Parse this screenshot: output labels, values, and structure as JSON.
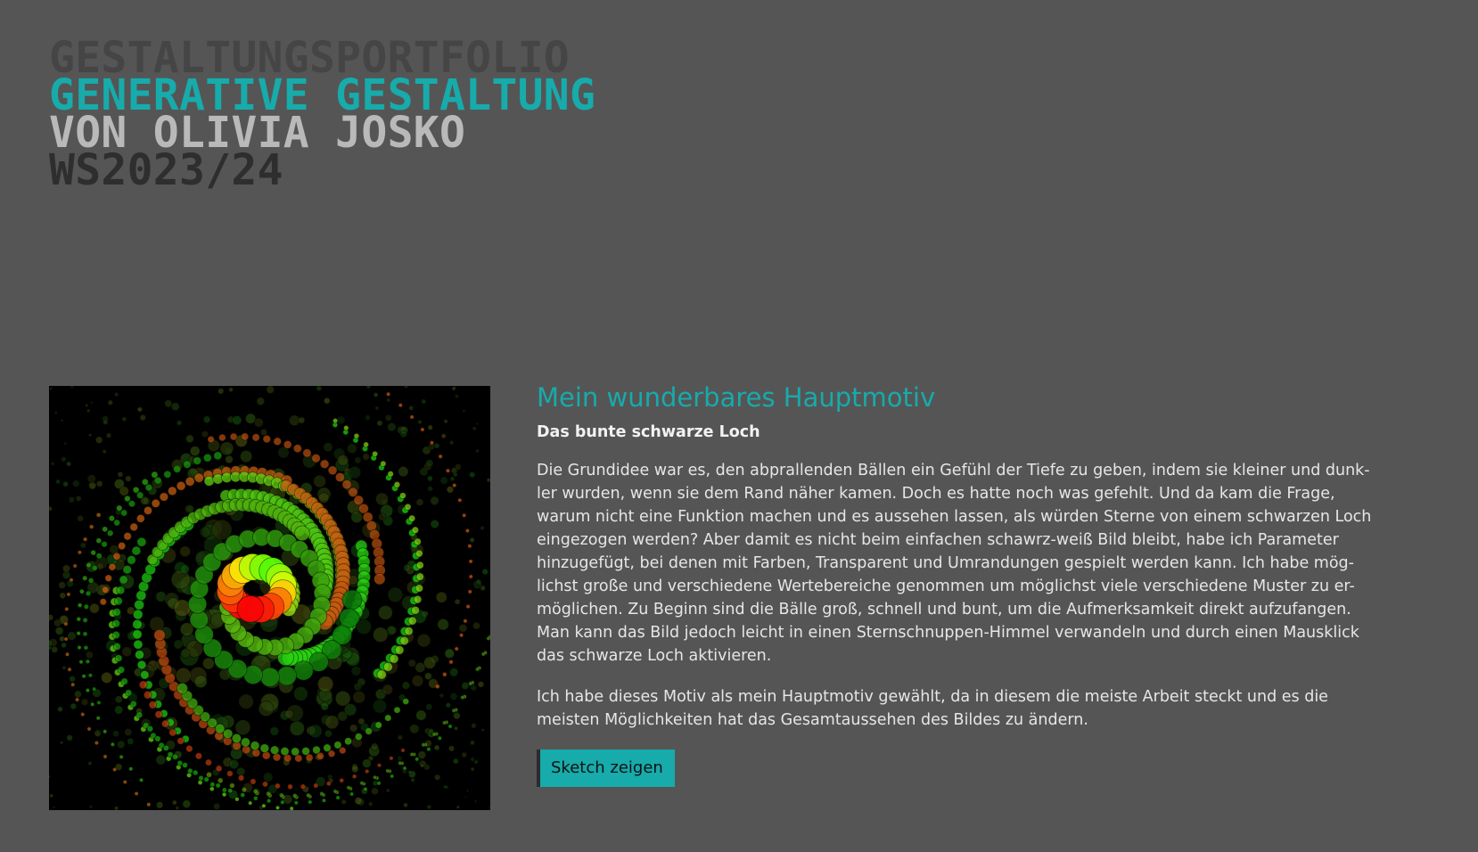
{
  "header": {
    "line1": "GESTALTUNGSPORTFOLIO",
    "line2": "GENERATIVE GESTALTUNG",
    "line3": "VON OLIVIA JOSKO",
    "line4": "WS2023/24"
  },
  "project": {
    "title": "Mein wunderbares Hauptmotiv",
    "subtitle": "Das bunte schwarze Loch",
    "paragraph1_lines": [
      "Die Grundidee war es, den abprallenden Bällen ein Gefühl der Tiefe zu geben, indem sie kleiner und dunk-",
      "ler wurden, wenn sie dem Rand näher kamen. Doch es hatte noch was gefehlt. Und da kam die Frage,",
      "warum nicht eine Funktion machen und es aussehen lassen, als würden Sterne von einem schwarzen Loch",
      "eingezogen werden? Aber damit es nicht beim einfachen schawrz-weiß Bild bleibt, habe ich Parameter",
      "hinzugefügt, bei denen mit Farben, Transparent und Umrandungen gespielt werden kann. Ich habe mög-",
      "lichst große und verschiedene Wertebereiche genommen um möglichst viele verschiedene Muster zu er-",
      "möglichen. Zu Beginn sind die Bälle groß, schnell und bunt, um die Aufmerksamkeit direkt aufzufangen.",
      "Man kann das Bild jedoch leicht in einen Sternschnuppen-Himmel verwandeln und durch einen Mausklick",
      "das schwarze Loch aktivieren."
    ],
    "paragraph2_lines": [
      "Ich habe dieses Motiv als mein Hauptmotiv gewählt, da in diesem die meiste Arbeit steckt und es die",
      "meisten Möglichkeiten hat das Gesamtaussehen des Bildes zu ändern."
    ],
    "button_label": "Sketch zeigen"
  },
  "colors": {
    "background": "#555555",
    "accent": "#17abab"
  }
}
